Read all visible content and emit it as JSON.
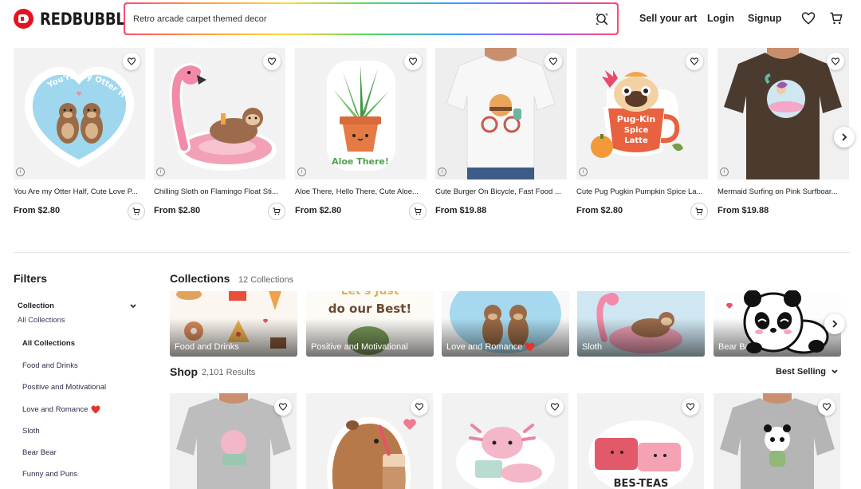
{
  "header": {
    "brand": "REDBUBBLE",
    "search_value": "Retro arcade carpet themed decor",
    "sell_label": "Sell your art",
    "login_label": "Login",
    "signup_label": "Signup",
    "icons": [
      "search-icon",
      "heart-icon",
      "cart-icon"
    ]
  },
  "carousel": {
    "items": [
      {
        "title": "You Are my Otter Half, Cute Love P...",
        "price": "From $2.80"
      },
      {
        "title": "Chilling Sloth on Flamingo Float Sti...",
        "price": "From $2.80"
      },
      {
        "title": "Aloe There, Hello There, Cute Aloe...",
        "price": "From $2.80"
      },
      {
        "title": "Cute Burger On Bicycle, Fast Food ...",
        "price": "From $19.88"
      },
      {
        "title": "Cute Pug Pugkin Pumpkin Spice La...",
        "price": "From $2.80"
      },
      {
        "title": "Mermaid Surfing on Pink Surfboar...",
        "price": "From $19.88"
      }
    ],
    "sticker_texts": {
      "otter": "You're my Otter Half",
      "aloe": "Aloe There!",
      "pug_line1": "Pug-Kin",
      "pug_line2": "Spice",
      "pug_line3": "Latte"
    }
  },
  "filters": {
    "title": "Filters",
    "group_label": "Collection",
    "group_value": "All Collections",
    "items": [
      {
        "label": "All Collections"
      },
      {
        "label": "Food and Drinks"
      },
      {
        "label": "Positive and Motivational"
      },
      {
        "label": "Love and Romance"
      },
      {
        "label": "Sloth"
      },
      {
        "label": "Bear Bear"
      },
      {
        "label": "Funny and Puns"
      }
    ]
  },
  "collections": {
    "title": "Collections",
    "count": "12 Collections",
    "cards": [
      {
        "label": "Food and Drinks"
      },
      {
        "label": "Positive and Motivational"
      },
      {
        "label": "Love and Romance"
      },
      {
        "label": "Sloth"
      },
      {
        "label": "Bear Bear"
      }
    ],
    "motivational_text_1": "Let's Just",
    "motivational_text_2": "do our Best!"
  },
  "shop": {
    "title": "Shop",
    "count": "2,101 Results",
    "sort_label": "Best Selling",
    "sticker_text": "BES-TEAS"
  },
  "colors": {
    "brand_red": "#e41321",
    "heart_red": "#e5332a"
  }
}
